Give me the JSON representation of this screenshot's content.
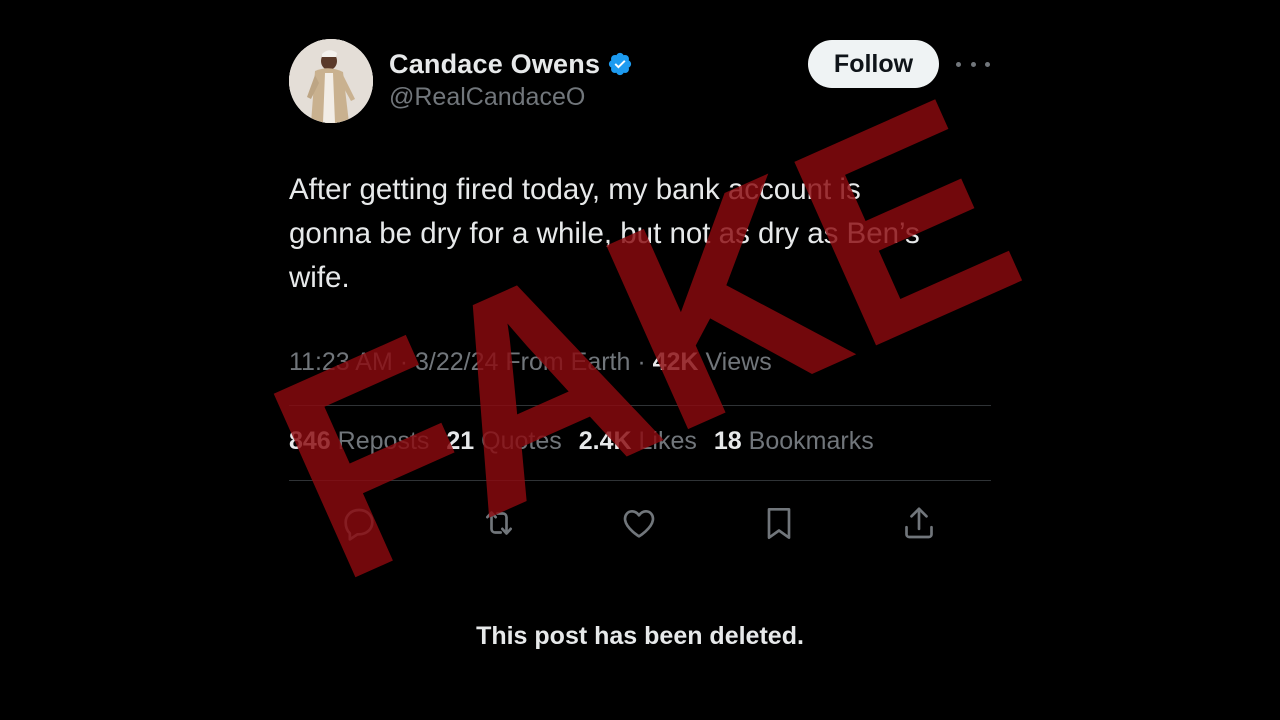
{
  "post": {
    "author": {
      "display_name": "Candace Owens",
      "handle": "@RealCandaceO",
      "verified": true
    },
    "follow_label": "Follow",
    "text": "After getting fired today, my bank account is\ngonna be dry for a while, but not as dry as Ben’s\nwife.",
    "meta": {
      "time": "11:23 AM",
      "separator": " · ",
      "date": "3/22/24",
      "location": "From Earth",
      "views_count": "42K",
      "views_label": "Views"
    },
    "stats": [
      {
        "count": "846",
        "label": "Reposts"
      },
      {
        "count": "21",
        "label": "Quotes"
      },
      {
        "count": "2.4K",
        "label": "Likes"
      },
      {
        "count": "18",
        "label": "Bookmarks"
      }
    ],
    "actions": [
      "reply-icon",
      "repost-icon",
      "like-icon",
      "bookmark-icon",
      "share-icon"
    ]
  },
  "deleted_notice": "This post has been deleted.",
  "stamp": {
    "text": "FAKE",
    "color": "#8b0a0f"
  },
  "colors": {
    "background": "#000000",
    "text_primary": "#e7e9ea",
    "text_secondary": "#71767b",
    "divider": "#2f3336",
    "verified": "#1d9bf0",
    "follow_bg": "#eff3f4"
  }
}
